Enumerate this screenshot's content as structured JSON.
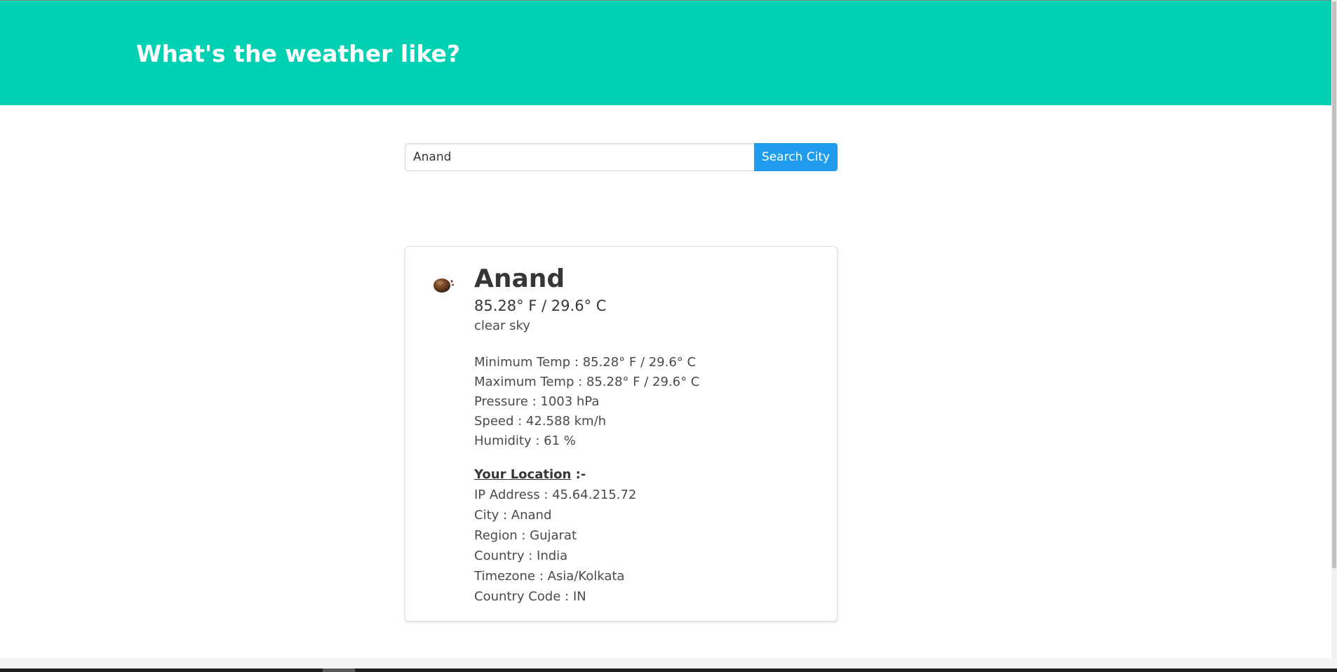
{
  "hero": {
    "title": "What's the weather like?",
    "background_color": "#00d1b2"
  },
  "search": {
    "value": "Anand",
    "button_label": "Search City",
    "button_color": "#209cee"
  },
  "weather": {
    "icon": "clear-sky-icon",
    "city": "Anand",
    "temperature": "85.28° F / 29.6° C",
    "description": "clear sky",
    "details": [
      "Minimum Temp : 85.28° F / 29.6° C",
      "Maximum Temp : 85.28° F / 29.6° C",
      "Pressure : 1003 hPa",
      "Speed : 42.588 km/h",
      "Humidity : 61 %"
    ]
  },
  "location": {
    "heading": "Your Location",
    "heading_suffix": " :-",
    "lines": [
      "IP Address : 45.64.215.72",
      "City : Anand",
      "Region : Gujarat",
      "Country : India",
      "Timezone : Asia/Kolkata",
      "Country Code : IN"
    ]
  }
}
